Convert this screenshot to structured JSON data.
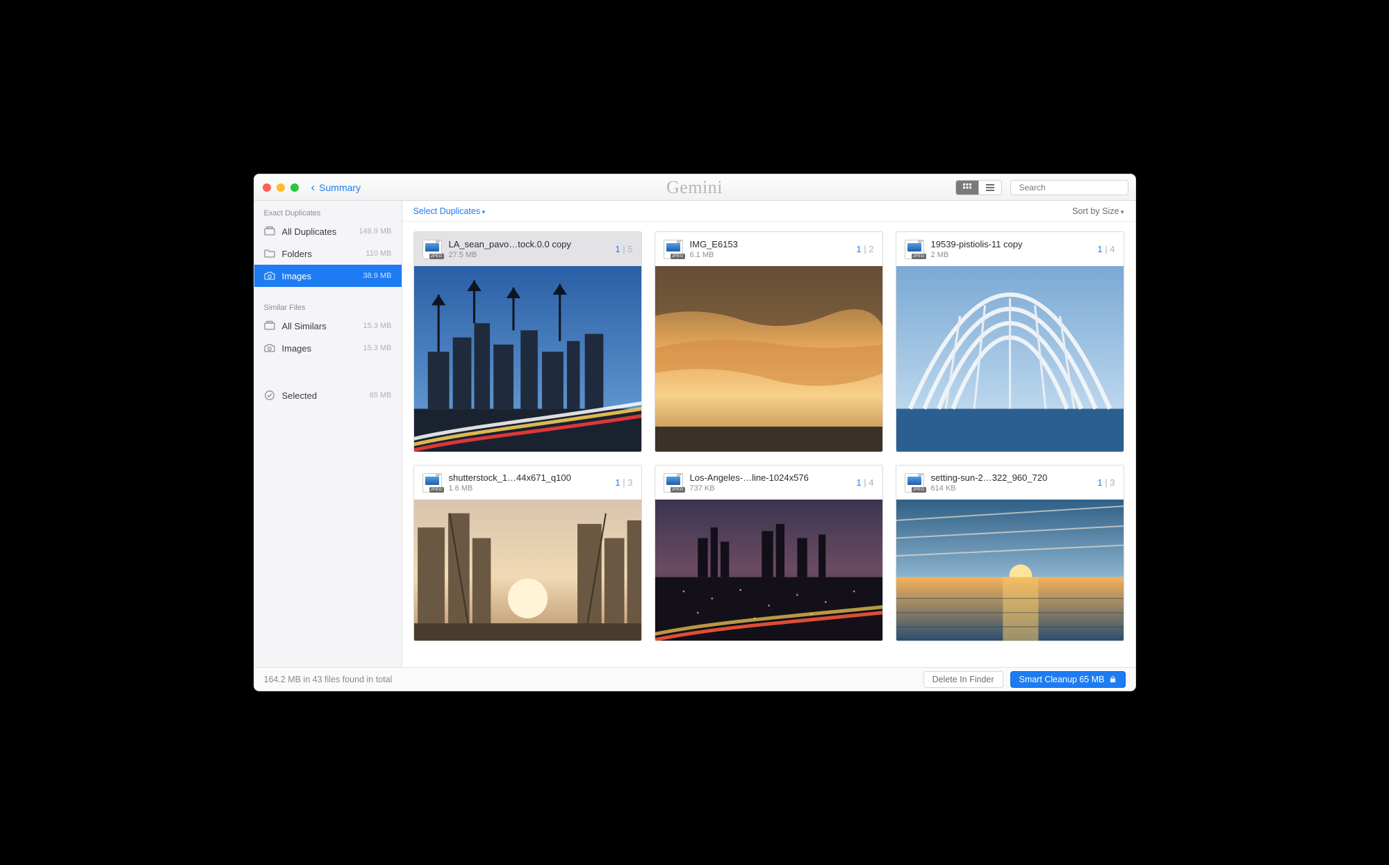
{
  "titlebar": {
    "back_label": "Summary",
    "app_name": "Gemini",
    "search_placeholder": "Search"
  },
  "sidebar": {
    "section_exact": "Exact Duplicates",
    "section_similar": "Similar Files",
    "exact_items": [
      {
        "label": "All Duplicates",
        "size": "148.9 MB"
      },
      {
        "label": "Folders",
        "size": "110 MB"
      },
      {
        "label": "Images",
        "size": "38.9 MB"
      }
    ],
    "similar_items": [
      {
        "label": "All Similars",
        "size": "15.3 MB"
      },
      {
        "label": "Images",
        "size": "15.3 MB"
      }
    ],
    "selected": {
      "label": "Selected",
      "size": "65 MB"
    }
  },
  "toolbar": {
    "select_duplicates": "Select Duplicates",
    "sort": "Sort by Size"
  },
  "cards": [
    {
      "name": "LA_sean_pavo…tock.0.0 copy",
      "size": "27.5 MB",
      "sel": "1",
      "tot": "5"
    },
    {
      "name": "IMG_E6153",
      "size": "6.1 MB",
      "sel": "1",
      "tot": "2"
    },
    {
      "name": "19539-pistiolis-11 copy",
      "size": "2 MB",
      "sel": "1",
      "tot": "4"
    },
    {
      "name": "shutterstock_1…44x671_q100",
      "size": "1.6 MB",
      "sel": "1",
      "tot": "3"
    },
    {
      "name": "Los-Angeles-…line-1024x576",
      "size": "737 KB",
      "sel": "1",
      "tot": "4"
    },
    {
      "name": "setting-sun-2…322_960_720",
      "size": "614 KB",
      "sel": "1",
      "tot": "3"
    }
  ],
  "footer": {
    "status": "164.2 MB in 43 files found in total",
    "delete": "Delete In Finder",
    "cleanup": "Smart Cleanup 65 MB"
  }
}
